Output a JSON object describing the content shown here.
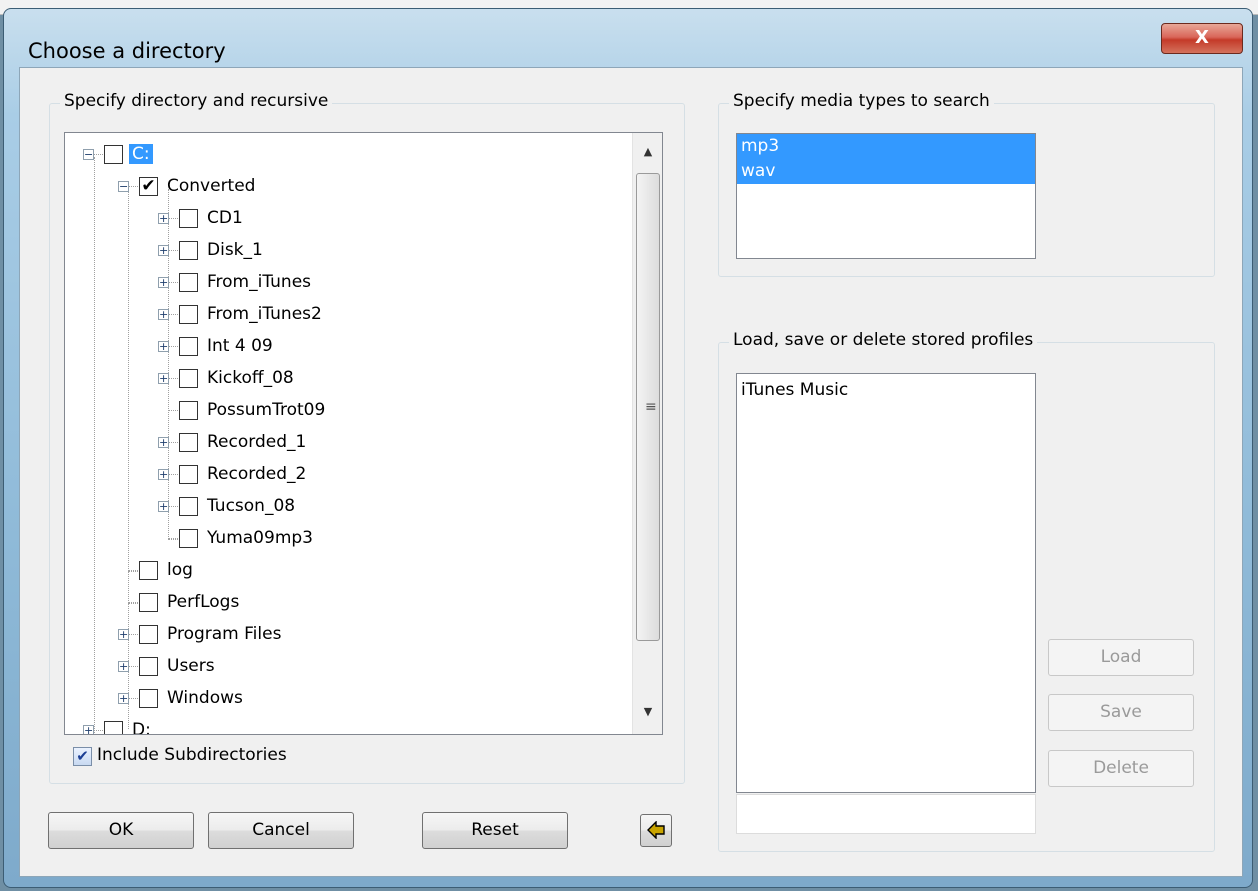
{
  "window": {
    "title": "Choose a directory",
    "close_label": "X"
  },
  "left_group": {
    "label": "Specify directory and recursive"
  },
  "tree": {
    "nodes": [
      {
        "label": "C:",
        "checked": false
      },
      {
        "label": "Converted",
        "checked": true
      },
      {
        "label": "CD1",
        "checked": false
      },
      {
        "label": "Disk_1",
        "checked": false
      },
      {
        "label": "From_iTunes",
        "checked": false
      },
      {
        "label": "From_iTunes2",
        "checked": false
      },
      {
        "label": "Int 4 09",
        "checked": false
      },
      {
        "label": "Kickoff_08",
        "checked": false
      },
      {
        "label": "PossumTrot09",
        "checked": false
      },
      {
        "label": "Recorded_1",
        "checked": false
      },
      {
        "label": "Recorded_2",
        "checked": false
      },
      {
        "label": "Tucson_08",
        "checked": false
      },
      {
        "label": "Yuma09mp3",
        "checked": false
      },
      {
        "label": "log",
        "checked": false
      },
      {
        "label": "PerfLogs",
        "checked": false
      },
      {
        "label": "Program Files",
        "checked": false
      },
      {
        "label": "Users",
        "checked": false
      },
      {
        "label": "Windows",
        "checked": false
      },
      {
        "label": "D:",
        "checked": false
      }
    ],
    "expand_minus": "−",
    "expand_plus": "+",
    "check_mark": "✔"
  },
  "include_subdirs": {
    "label": "Include Subdirectories",
    "checked": true,
    "mark": "✔"
  },
  "buttons": {
    "ok": "OK",
    "cancel": "Cancel",
    "reset": "Reset",
    "back_icon": "arrow-left-icon"
  },
  "media_group": {
    "label": "Specify media types to search",
    "items": [
      "mp3",
      "wav"
    ]
  },
  "profiles_group": {
    "label": "Load, save or delete stored profiles",
    "items": [
      "iTunes Music"
    ],
    "name_value": "",
    "load": "Load",
    "save": "Save",
    "delete": "Delete"
  },
  "colors": {
    "selection": "#3399ff",
    "title_gradient_top": "#c9dfee",
    "close_red": "#c43a29"
  }
}
